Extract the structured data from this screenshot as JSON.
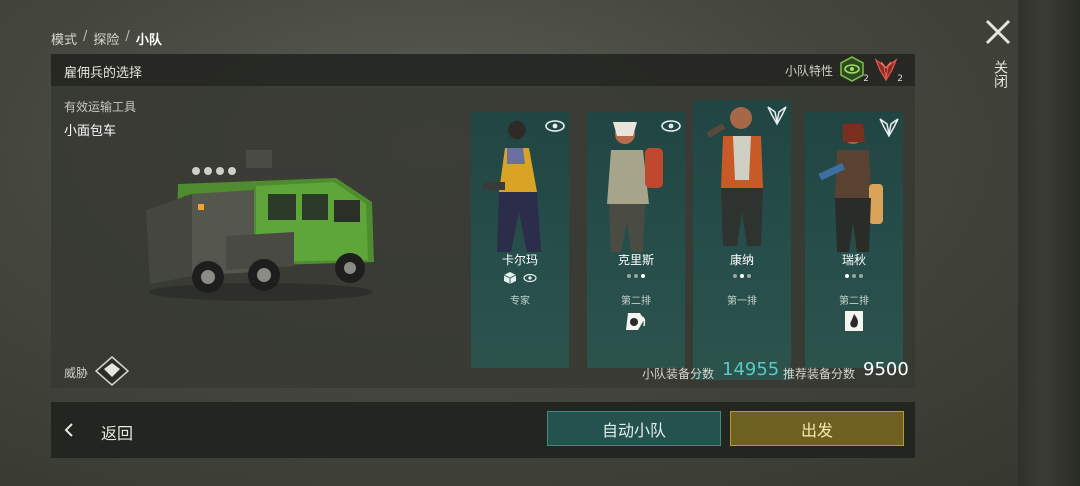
{
  "breadcrumb": {
    "mode": "模式",
    "explore": "探险",
    "current": "小队",
    "sep": "/"
  },
  "close": {
    "label": "关闭",
    "icon": "close-x-icon"
  },
  "panel": {
    "title": "雇佣兵的选择",
    "traits_label": "小队特性",
    "traits": [
      {
        "icon": "eye-emblem-icon",
        "count": "2",
        "color": "#7fc24a"
      },
      {
        "icon": "wing-emblem-icon",
        "count": "2",
        "color": "#d24a3c"
      }
    ]
  },
  "vehicle": {
    "type_label": "有效运输工具",
    "name": "小面包车"
  },
  "mercenaries": [
    {
      "name": "卡尔玛",
      "role": "专家",
      "badge": "eye-badge-icon",
      "indicator": "icons"
    },
    {
      "name": "克里斯",
      "role": "第二排",
      "badge": "eye-badge-icon",
      "indicator": "dots",
      "dots": [
        false,
        false,
        true
      ],
      "skill_icon": "grenade-skill-icon"
    },
    {
      "name": "康纳",
      "role": "第一排",
      "badge": "wing-badge-icon",
      "indicator": "dots",
      "dots": [
        false,
        true,
        false
      ]
    },
    {
      "name": "瑞秋",
      "role": "第二排",
      "badge": "wing-badge-icon",
      "indicator": "dots",
      "dots": [
        true,
        false,
        false
      ],
      "skill_icon": "fire-skill-icon"
    }
  ],
  "threat": {
    "label": "威胁",
    "icon": "threat-gem-icon"
  },
  "scores": {
    "squad_label": "小队装备分数",
    "squad_value": "14955",
    "recommended_label": "推荐装备分数",
    "recommended_value": "9500",
    "squad_color": "#59c9c4"
  },
  "bottom": {
    "back_label": "返回",
    "auto_label": "自动小队",
    "go_label": "出发"
  }
}
